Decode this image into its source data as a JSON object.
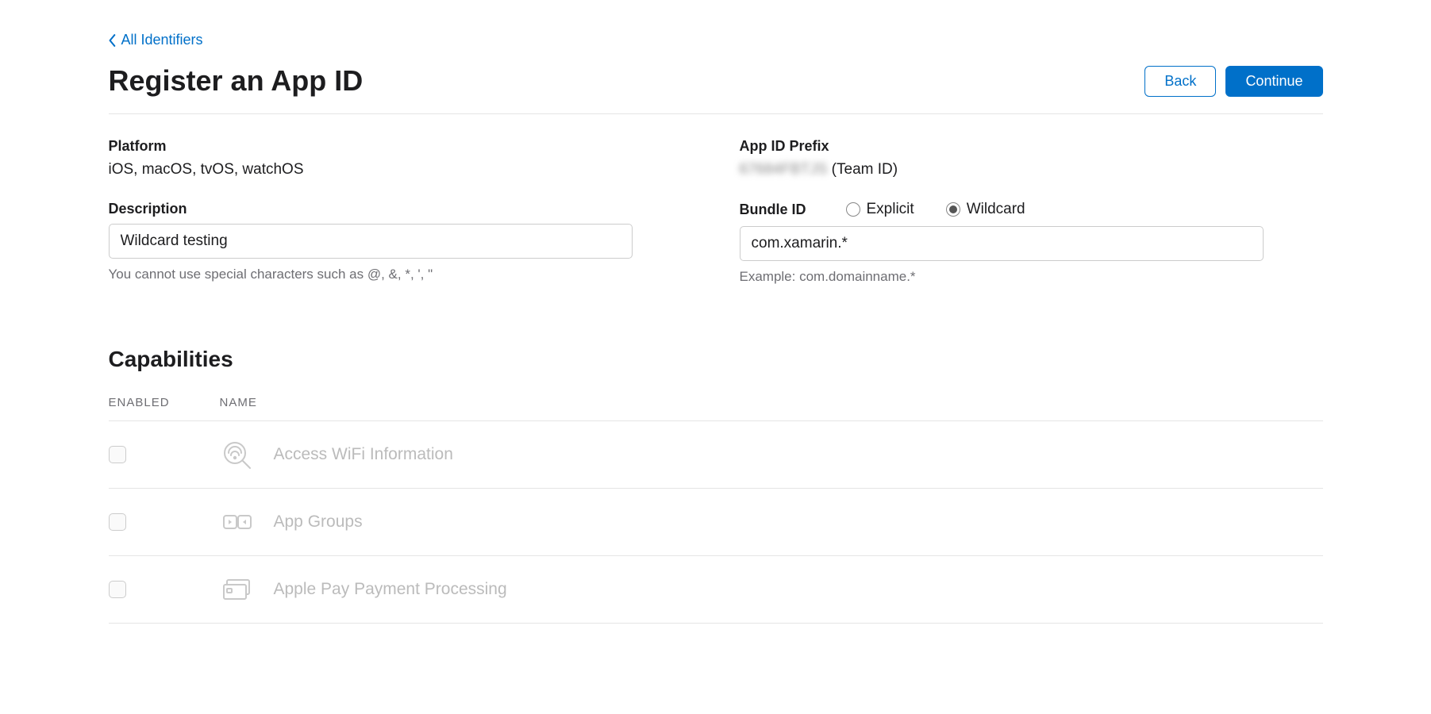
{
  "breadcrumb": {
    "label": "All Identifiers"
  },
  "header": {
    "title": "Register an App ID",
    "back_label": "Back",
    "continue_label": "Continue"
  },
  "form": {
    "platform": {
      "label": "Platform",
      "value": "iOS, macOS, tvOS, watchOS"
    },
    "app_id_prefix": {
      "label": "App ID Prefix",
      "masked_value": "67684FBTJS",
      "suffix": " (Team ID)"
    },
    "description": {
      "label": "Description",
      "value": "Wildcard testing",
      "help": "You cannot use special characters such as @, &, *, ', \""
    },
    "bundle_id": {
      "label": "Bundle ID",
      "explicit_label": "Explicit",
      "wildcard_label": "Wildcard",
      "selected": "wildcard",
      "value": "com.xamarin.*",
      "help": "Example: com.domainname.*"
    }
  },
  "capabilities": {
    "title": "Capabilities",
    "col_enabled": "ENABLED",
    "col_name": "NAME",
    "rows": [
      {
        "name": "Access WiFi Information"
      },
      {
        "name": "App Groups"
      },
      {
        "name": "Apple Pay Payment Processing"
      }
    ]
  }
}
